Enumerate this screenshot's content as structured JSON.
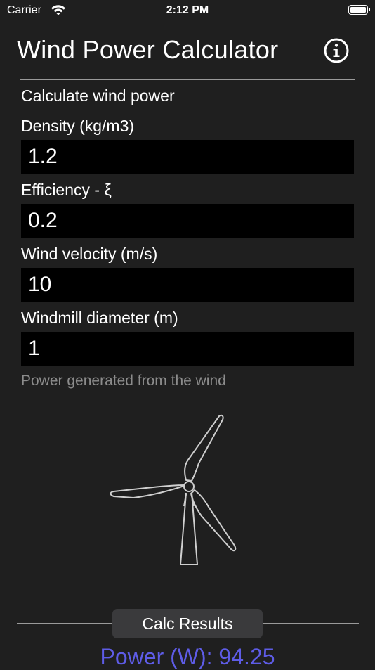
{
  "status_bar": {
    "carrier": "Carrier",
    "time": "2:12 PM",
    "icons": [
      "wifi-icon",
      "battery-icon"
    ]
  },
  "header": {
    "title": "Wind Power Calculator",
    "info_icon": "info-circle-icon"
  },
  "form": {
    "section_title": "Calculate wind power",
    "density_label": "Density (kg/m3)",
    "density_value": "1.2",
    "efficiency_label": "Efficiency - ξ",
    "efficiency_value": "0.2",
    "velocity_label": "Wind velocity (m/s)",
    "velocity_value": "10",
    "diameter_label": "Windmill diameter (m)",
    "diameter_value": "1",
    "hint": "Power generated from the wind"
  },
  "illustration": {
    "icon": "wind-turbine-icon"
  },
  "actions": {
    "calc_label": "Calc Results"
  },
  "result": {
    "text": "Power (W): 94.25"
  },
  "colors": {
    "background": "#1f1f1f",
    "field_background": "#000000",
    "accent": "#5e5ce6",
    "button_background": "#3a3a3c",
    "hint_text": "#8c8c8c"
  }
}
